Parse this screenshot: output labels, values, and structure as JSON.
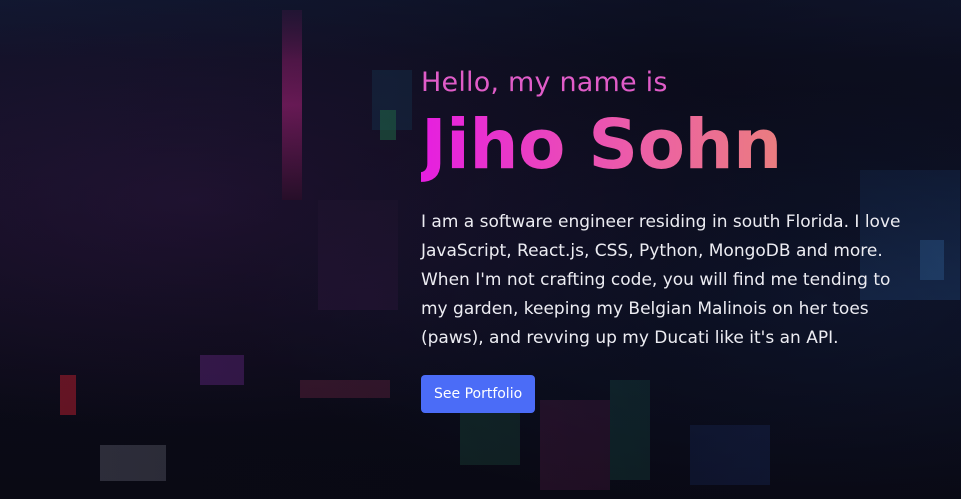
{
  "hero": {
    "greeting": "Hello, my name is",
    "name": "Jiho Sohn",
    "bio": "I am a software engineer residing in south Florida. I love JavaScript, React.js, CSS, Python, MongoDB and more. When I'm not crafting code, you will find me tending to my garden, keeping my Belgian Malinois on her toes (paws), and revving up my Ducati like it's an API.",
    "cta_label": "See Portfolio"
  },
  "colors": {
    "greeting": "#e05cc8",
    "name_gradient_start": "#e61ee0",
    "name_gradient_end": "#e99a5a",
    "button": "#4b6cf7",
    "background": "#0b0b1a"
  }
}
